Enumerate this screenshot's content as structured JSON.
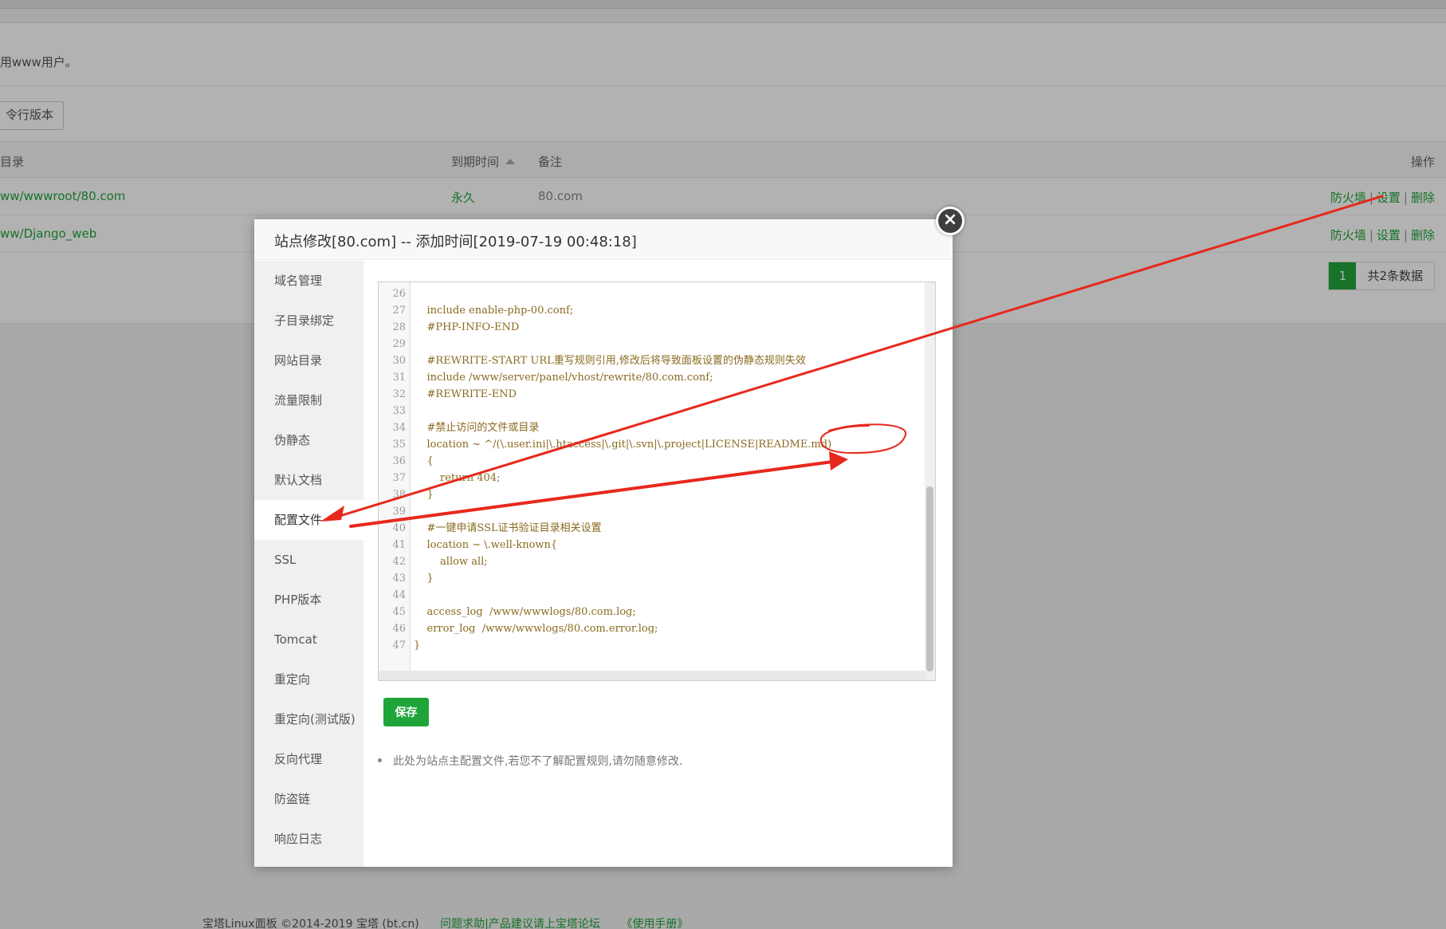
{
  "background": {
    "notice": "用www用户。",
    "php_button": "令行版本",
    "table": {
      "headers": {
        "dir": "目录",
        "expire": "到期时间",
        "note": "备注",
        "ops": "操作"
      },
      "rows": [
        {
          "path": "ww/wwwroot/80.com",
          "expire": "永久",
          "note": "80.com",
          "ops": [
            "防火墙",
            "设置",
            "删除"
          ]
        },
        {
          "path": "ww/Django_web",
          "expire": "",
          "note": "",
          "ops": [
            "防火墙",
            "设置",
            "删除"
          ]
        }
      ]
    },
    "pager": {
      "current": "1",
      "total": "共2条数据"
    },
    "footer": {
      "copyright": "宝塔Linux面板 ©2014-2019 宝塔 (bt.cn)",
      "link1": "问题求助|产品建议请上宝塔论坛",
      "link2": "《使用手册》"
    }
  },
  "modal": {
    "title": "站点修改[80.com] -- 添加时间[2019-07-19 00:48:18]",
    "close_icon": "close-icon",
    "nav": [
      "域名管理",
      "子目录绑定",
      "网站目录",
      "流量限制",
      "伪静态",
      "默认文档",
      "配置文件",
      "SSL",
      "PHP版本",
      "Tomcat",
      "重定向",
      "重定向(测试版)",
      "反向代理",
      "防盗链",
      "响应日志"
    ],
    "active_nav": "配置文件",
    "code": [
      {
        "n": "26",
        "t": ""
      },
      {
        "n": "27",
        "t": "    include enable-php-00.conf;"
      },
      {
        "n": "28",
        "t": "    #PHP-INFO-END"
      },
      {
        "n": "29",
        "t": ""
      },
      {
        "n": "30",
        "t": "    #REWRITE-START URL重写规则引用,修改后将导致面板设置的伪静态规则失效"
      },
      {
        "n": "31",
        "t": "    include /www/server/panel/vhost/rewrite/80.com.conf;"
      },
      {
        "n": "32",
        "t": "    #REWRITE-END"
      },
      {
        "n": "33",
        "t": ""
      },
      {
        "n": "34",
        "t": "    #禁止访问的文件或目录"
      },
      {
        "n": "35",
        "t": "    location ~ ^/(\\.user.ini|\\.htaccess|\\.git|\\.svn|\\.project|LICENSE|README.md)"
      },
      {
        "n": "36",
        "t": "    {"
      },
      {
        "n": "37",
        "t": "        return 404;"
      },
      {
        "n": "38",
        "t": "    }"
      },
      {
        "n": "39",
        "t": ""
      },
      {
        "n": "40",
        "t": "    #一键申请SSL证书验证目录相关设置"
      },
      {
        "n": "41",
        "t": "    location ~ \\.well-known{"
      },
      {
        "n": "42",
        "t": "        allow all;"
      },
      {
        "n": "43",
        "t": "    }"
      },
      {
        "n": "44",
        "t": ""
      },
      {
        "n": "45",
        "t": "    access_log  /www/wwwlogs/80.com.log;"
      },
      {
        "n": "46",
        "t": "    error_log  /www/wwwlogs/80.com.error.log;"
      },
      {
        "n": "47",
        "t": "}"
      }
    ],
    "save_label": "保存",
    "tip": "此处为站点主配置文件,若您不了解配置规则,请勿随意修改."
  },
  "colors": {
    "accent": "#20a53a",
    "annotation": "#e8281c"
  }
}
